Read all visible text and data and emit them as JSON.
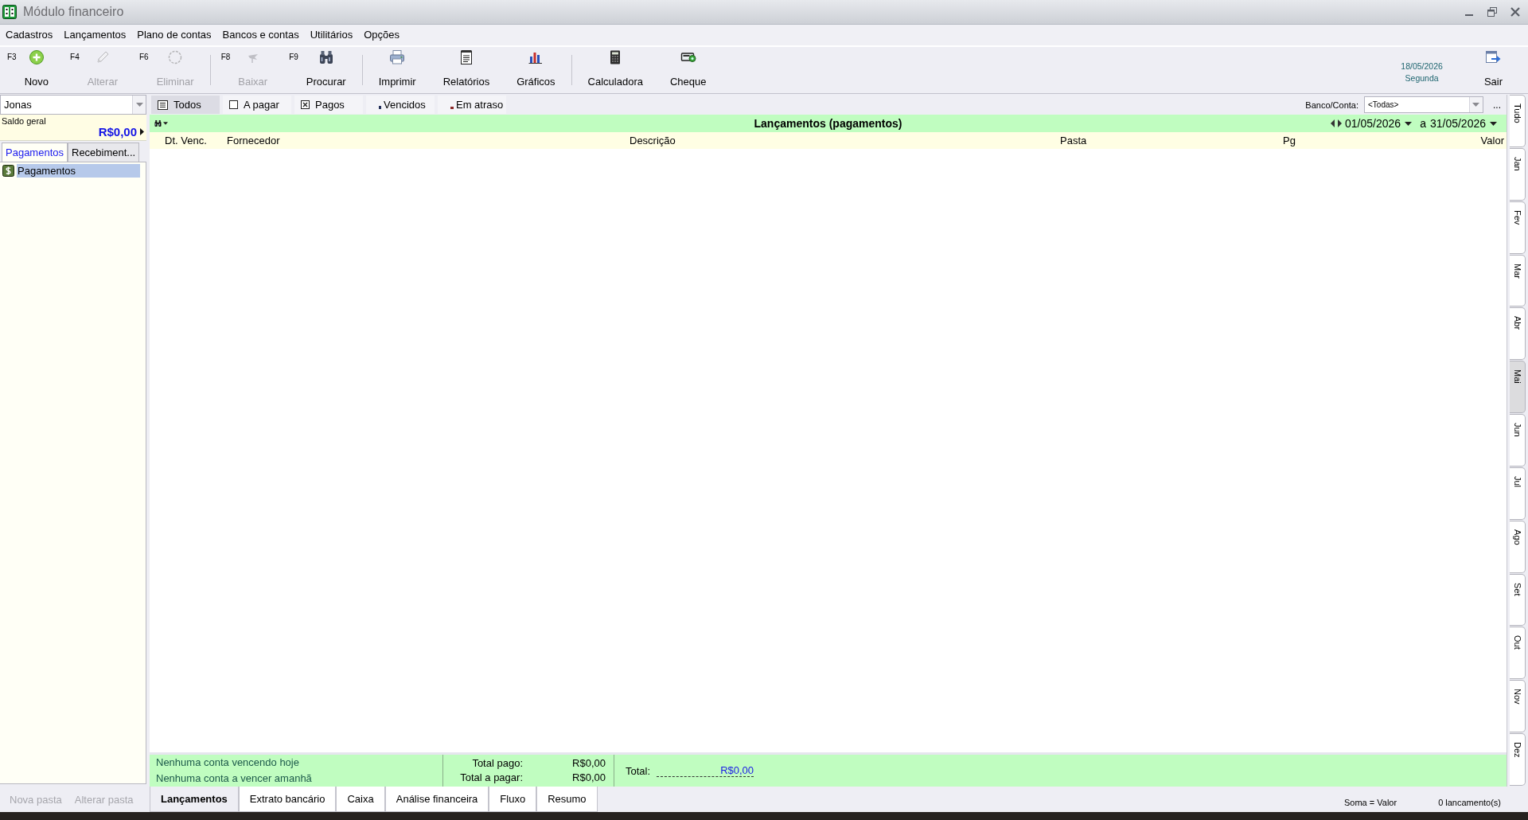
{
  "window": {
    "title": "Módulo financeiro"
  },
  "menu": [
    {
      "label": "Cadastros"
    },
    {
      "label": "Lançamentos"
    },
    {
      "label": "Plano de contas"
    },
    {
      "label": "Bancos e contas"
    },
    {
      "label": "Utilitários"
    },
    {
      "label": "Opções"
    }
  ],
  "toolbar": {
    "groups": [
      [
        {
          "shortcut": "F3",
          "label": "Novo",
          "disabled": false
        },
        {
          "shortcut": "F4",
          "label": "Alterar",
          "disabled": true
        },
        {
          "shortcut": "F6",
          "label": "Eliminar",
          "disabled": true
        }
      ],
      [
        {
          "shortcut": "F8",
          "label": "Baixar",
          "disabled": true
        },
        {
          "shortcut": "F9",
          "label": "Procurar",
          "disabled": false
        }
      ],
      [
        {
          "label": "Imprimir",
          "disabled": false
        },
        {
          "label": "Relatórios",
          "disabled": false
        },
        {
          "label": "Gráficos",
          "disabled": false
        }
      ],
      [
        {
          "label": "Calculadora",
          "disabled": false
        },
        {
          "label": "Cheque",
          "disabled": false
        }
      ]
    ],
    "date": "18/05/2026",
    "weekday": "Segunda",
    "exit_button": {
      "label": "Sair"
    }
  },
  "sidebar": {
    "account": {
      "value": "Jonas"
    },
    "balance": {
      "label": "Saldo geral",
      "amount": "R$0,00"
    },
    "tabs": [
      {
        "label": "Pagamentos",
        "selected": true
      },
      {
        "label": "Recebiment...",
        "selected": false
      }
    ],
    "tree": [
      {
        "label": "Pagamentos",
        "selected": true
      }
    ],
    "buttons": [
      {
        "label": "Nova pasta",
        "disabled": true
      },
      {
        "label": "Alterar pasta",
        "disabled": true
      }
    ]
  },
  "filters": [
    {
      "label": "Todos",
      "selected": true
    },
    {
      "label": "A pagar",
      "selected": false
    },
    {
      "label": "Pagos",
      "selected": false
    },
    {
      "label": "Vencidos",
      "selected": false
    },
    {
      "label": "Em atraso",
      "selected": false
    }
  ],
  "account_filter": {
    "label": "Banco/Conta:",
    "value": "<Todas>",
    "more_button": "..."
  },
  "ledger": {
    "title": "Lançamentos (pagamentos)",
    "date_from": "01/05/2026",
    "date_to_label": "a",
    "date_to": "31/05/2026",
    "columns": [
      "Dt. Venc.",
      "Fornecedor",
      "Descrição",
      "Pasta",
      "Pg",
      "Valor"
    ]
  },
  "summary": {
    "notices": [
      "Nenhuma conta vencendo hoje",
      "Nenhuma conta a vencer amanhã"
    ],
    "totals": [
      {
        "label": "Total pago:",
        "value": "R$0,00"
      },
      {
        "label": "Total a pagar:",
        "value": "R$0,00"
      }
    ],
    "total": {
      "label": "Total:",
      "value": "R$0,00"
    }
  },
  "bottom_tabs": [
    {
      "label": "Lançamentos",
      "selected": true
    },
    {
      "label": "Extrato bancário",
      "selected": false
    },
    {
      "label": "Caixa",
      "selected": false
    },
    {
      "label": "Análise financeira",
      "selected": false
    },
    {
      "label": "Fluxo",
      "selected": false
    },
    {
      "label": "Resumo",
      "selected": false
    }
  ],
  "status_bar": {
    "sum_mode": "Soma = Valor",
    "count": "0 lancamento(s)"
  },
  "months": [
    {
      "label": "Tudo",
      "selected": false
    },
    {
      "label": "Jan",
      "selected": false
    },
    {
      "label": "Fev",
      "selected": false
    },
    {
      "label": "Mar",
      "selected": false
    },
    {
      "label": "Abr",
      "selected": false
    },
    {
      "label": "Mai",
      "selected": true
    },
    {
      "label": "Jun",
      "selected": false
    },
    {
      "label": "Jul",
      "selected": false
    },
    {
      "label": "Ago",
      "selected": false
    },
    {
      "label": "Set",
      "selected": false
    },
    {
      "label": "Out",
      "selected": false
    },
    {
      "label": "Nov",
      "selected": false
    },
    {
      "label": "Dez",
      "selected": false
    }
  ]
}
